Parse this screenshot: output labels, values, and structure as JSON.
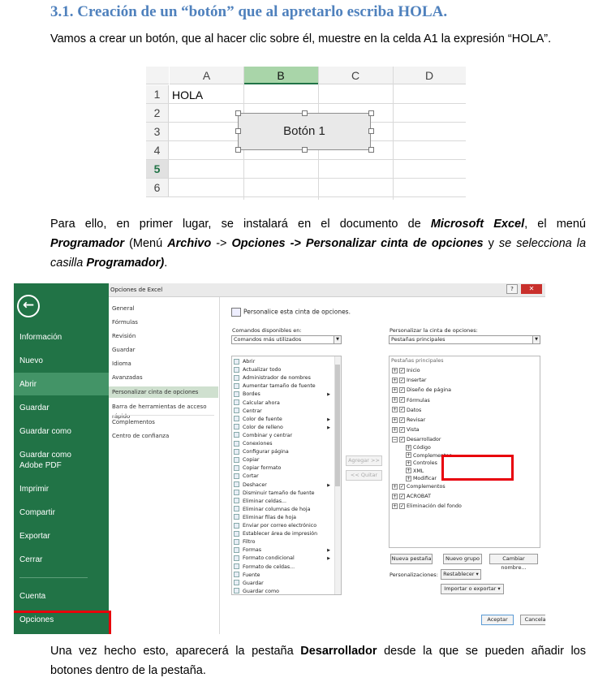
{
  "heading": "3.1.  Creación de un “botón” que al apretarlo escriba HOLA.",
  "intro": "Vamos a crear un botón, que al hacer clic sobre él, muestre en la celda A1 la expresión “HOLA”.",
  "sheet": {
    "columns": [
      "A",
      "B",
      "C",
      "D"
    ],
    "rows": [
      "1",
      "2",
      "3",
      "4",
      "5",
      "6"
    ],
    "cell_a1": "HOLA",
    "button_label": "Botón 1"
  },
  "para2": {
    "l1_a": "Para ello, en primer lugar, se instalará en el documento de ",
    "l1_b": "Microsoft Excel",
    "l1_c": ", el menú",
    "l2_a": "Programador",
    "l2_b": " (Menú ",
    "l2_c": "Archivo",
    "l2_d": " -> ",
    "l2_e": "Opciones -> Personalizar cinta de opciones",
    "l2_f": " y ",
    "l2_g": "se selecciona la",
    "l3_a": "casilla ",
    "l3_b": "Programador)",
    "l3_c": "."
  },
  "backstage": {
    "items": [
      "Información",
      "Nuevo",
      "Abrir",
      "Guardar",
      "Guardar como",
      "Guardar como Adobe PDF",
      "Imprimir",
      "Compartir",
      "Exportar",
      "Cerrar",
      "Cuenta",
      "Opciones"
    ]
  },
  "dialog": {
    "title": "Opciones de Excel",
    "help": "?",
    "close": "✕",
    "nav": [
      "General",
      "Fórmulas",
      "Revisión",
      "Guardar",
      "Idioma",
      "Avanzadas",
      "Personalizar cinta de opciones",
      "Barra de herramientas de acceso rápido",
      "Complementos",
      "Centro de confianza"
    ],
    "panel_title": "Personalice esta cinta de opciones.",
    "commands_label": "Comandos disponibles en:",
    "commands_value": "Comandos más utilizados",
    "ribbon_label": "Personalizar la cinta de opciones:",
    "ribbon_value": "Pestañas principales",
    "commands": [
      "Abrir",
      "Actualizar todo",
      "Administrador de nombres",
      "Aumentar tamaño de fuente",
      "Bordes",
      "Calcular ahora",
      "Centrar",
      "Color de fuente",
      "Color de relleno",
      "Combinar y centrar",
      "Conexiones",
      "Configurar página",
      "Copiar",
      "Copiar formato",
      "Cortar",
      "Deshacer",
      "Disminuir tamaño de fuente",
      "Eliminar celdas...",
      "Eliminar columnas de hoja",
      "Eliminar filas de hoja",
      "Enviar por correo electrónico",
      "Establecer área de impresión",
      "Filtro",
      "Formas",
      "Formato condicional",
      "Formato de celdas...",
      "Fuente",
      "Guardar",
      "Guardar como"
    ],
    "add_button": "Agregar >>",
    "remove_button": "<< Quitar",
    "tree_header": "Pestañas principales",
    "tree": [
      "Inicio",
      "Insertar",
      "Diseño de página",
      "Fórmulas",
      "Datos",
      "Revisar",
      "Vista",
      "Desarrollador",
      "Código",
      "Complementos",
      "Controles",
      "XML",
      "Modificar",
      "Complementos",
      "ACROBAT",
      "Eliminación del fondo"
    ],
    "new_tab": "Nueva pestaña",
    "new_group": "Nuevo grupo",
    "rename": "Cambiar nombre...",
    "customizations_label": "Personalizaciones:",
    "reset": "Restablecer ▾",
    "import_export": "Importar o exportar ▾",
    "ok": "Aceptar",
    "cancel": "Cancelar"
  },
  "para3": {
    "l1_a": "Una vez hecho esto, aparecerá la pestaña ",
    "l1_b": "Desarrollador",
    "l1_c": " desde la que se pueden añadir los",
    "l2": "botones dentro de la pestaña."
  },
  "colors": {
    "heading": "#4f81bd",
    "excel_green": "#217346",
    "highlight_red": "#e8000b"
  }
}
